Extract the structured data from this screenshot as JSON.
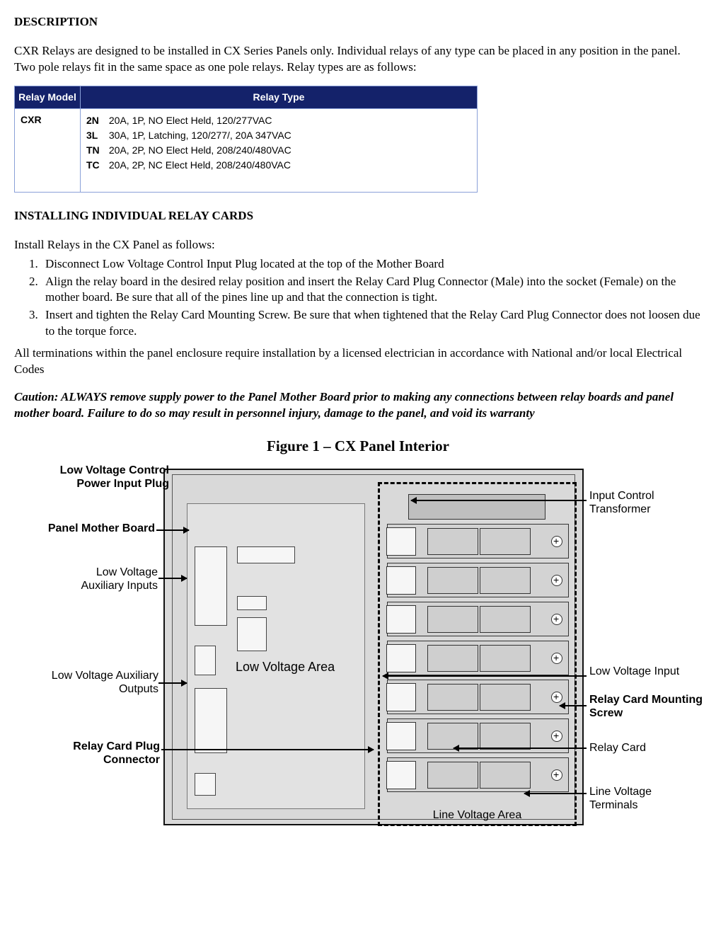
{
  "heading_description": "DESCRIPTION",
  "description_text": "CXR Relays are designed to be installed in CX Series Panels only. Individual relays of any type can be placed in any position in the panel. Two pole relays fit in the same space as one pole relays. Relay types are as follows:",
  "table": {
    "col_model": "Relay Model",
    "col_type": "Relay Type",
    "model": "CXR",
    "types": [
      {
        "code": "2N",
        "desc": "20A, 1P, NO Elect Held, 120/277VAC"
      },
      {
        "code": "3L",
        "desc": "30A, 1P, Latching, 120/277/, 20A 347VAC"
      },
      {
        "code": "TN",
        "desc": "20A, 2P, NO Elect Held, 208/240/480VAC"
      },
      {
        "code": "TC",
        "desc": "20A, 2P, NC Elect Held, 208/240/480VAC"
      }
    ]
  },
  "heading_install": "INSTALLING INDIVIDUAL RELAY CARDS",
  "install_intro": "Install Relays in the CX Panel as follows:",
  "install_steps": [
    "Disconnect Low Voltage Control Input Plug located at the top of the Mother Board",
    "Align the relay board in the desired relay position and insert the Relay Card Plug Connector (Male) into the socket (Female) on the mother board. Be sure that all of the pines line up and that the connection is tight.",
    "Insert and tighten the Relay Card Mounting Screw. Be sure that when tightened that the Relay Card Plug Connector does not loosen due to the torque force."
  ],
  "install_note": "All terminations within the panel enclosure require installation by a licensed electrician in accordance with National and/or local Electrical Codes",
  "caution_text": "Caution: ALWAYS remove supply power to the Panel Mother Board prior to making any connections between relay boards and panel mother board. Failure to do so may result in personnel injury, damage to the panel, and void its warranty",
  "figure_title": "Figure 1 – CX Panel Interior",
  "figure_labels": {
    "lv_plug": "Low Voltage Control Power Input Plug",
    "mother_board": "Panel Mother Board",
    "aux_in": "Low Voltage Auxiliary Inputs",
    "aux_out": "Low Voltage Auxiliary Outputs",
    "plug_connector": "Relay Card Plug Connector",
    "lv_area": "Low Voltage Area",
    "line_voltage_area": "Line Voltage Area",
    "transformer": "Input Control Transformer",
    "lv_input": "Low Voltage Input",
    "mount_screw": "Relay Card Mounting Screw",
    "relay_card": "Relay Card",
    "line_terminals": "Line Voltage Terminals"
  }
}
